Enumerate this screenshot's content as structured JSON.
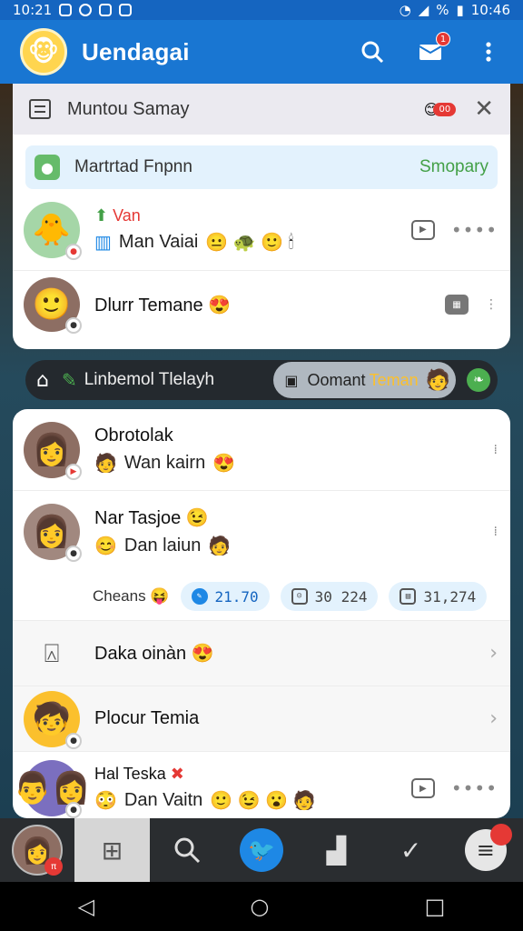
{
  "status_bar": {
    "time_left": "10:21",
    "time_right": "10:46",
    "battery": "%"
  },
  "app_bar": {
    "title": "Uendagai",
    "mail_badge": "1"
  },
  "card1": {
    "header_title": "Muntou Samay",
    "header_badge": "00",
    "banner": {
      "text": "Martrtad Fnpnn",
      "status": "Smopary"
    },
    "rows": [
      {
        "label": "Van",
        "sub": "Man Vaiai"
      },
      {
        "name": "Dlurr Temane"
      }
    ]
  },
  "pill_bar": {
    "text": "Linbemol Tlelayh",
    "chip_text": "Oomant",
    "chip_text_accent": "Teman"
  },
  "card2": {
    "rows": [
      {
        "name": "Obrotolak",
        "sub": "Wan kairn"
      },
      {
        "name": "Nar Tasjoe",
        "sub": "Dan laiun"
      }
    ],
    "stats": {
      "label": "Cheans",
      "values": [
        "21.70",
        "30 224",
        "31,274"
      ]
    },
    "list": [
      {
        "name": "Daka oinàn"
      },
      {
        "name": "Plocur Temia"
      },
      {
        "name": "Hal Teska",
        "sub": "Dan Vaitn"
      }
    ]
  },
  "icons": [
    "search-icon",
    "mail-icon",
    "more-icon",
    "close-icon",
    "home-icon",
    "edit-icon",
    "grid-icon",
    "bird-icon",
    "menu-icon"
  ]
}
